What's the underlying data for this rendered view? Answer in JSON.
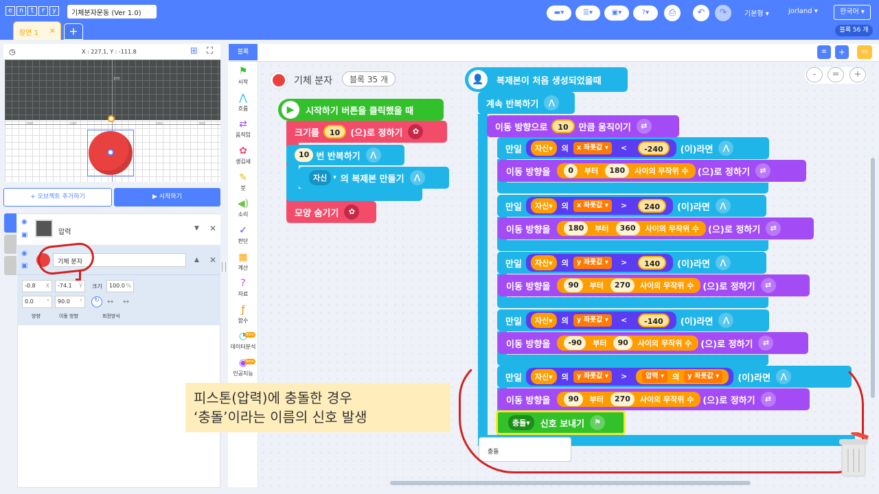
{
  "app": {
    "logo": "entry",
    "project_title": "기체분자운동 (Ver 1.0)"
  },
  "scene_tab": {
    "label": "장면 1",
    "close": "×",
    "add": "+"
  },
  "toolbar": {
    "help": "?",
    "mode": "기본형",
    "user": "jorland",
    "language": "한국어",
    "block_count": "블록 56 개"
  },
  "stage": {
    "coords": "X : 227.1, Y : -111.8",
    "axis_ticks": [
      "-200",
      "-100",
      "100",
      "200"
    ],
    "y_tick": "100"
  },
  "buttons": {
    "add_object": "+ 오브젝트 추가하기",
    "start": "▶ 시작하기"
  },
  "objects": [
    {
      "name": "압력"
    },
    {
      "name": "기체 분자"
    }
  ],
  "object_props": {
    "x": "-0.8",
    "x_unit": "X",
    "y": "-74.1",
    "y_unit": "Y",
    "size_label": "크기",
    "size": "100.0",
    "size_unit": "%",
    "direction": "0.0",
    "direction_unit": "°",
    "move_direction": "90.0",
    "move_unit": "°",
    "direction_label": "방향",
    "move_direction_label": "이동 방향",
    "rotation_label": "회전방식"
  },
  "palette": {
    "tab": "블록",
    "categories": [
      "시작",
      "흐름",
      "움직임",
      "생김새",
      "붓",
      "소리",
      "판단",
      "계산",
      "자료",
      "함수",
      "데이터분석",
      "인공지능"
    ],
    "beta": "Beta"
  },
  "workspace": {
    "object_header": {
      "name": "기체 분자",
      "count": "블록 35 개"
    },
    "script1": {
      "hat": "시작하기 버튼을 클릭했을 때",
      "b1_pre": "크기를",
      "b1_val": "10",
      "b1_post": "(으)로 정하기",
      "rep_val": "10",
      "rep_post": "번 반복하기",
      "clone_target": "자신",
      "clone_post": "의 복제본 만들기",
      "hide": "모양 숨기기"
    },
    "script2": {
      "hat": "복제본이 처음 생성되었을때",
      "loop": "계속 반복하기",
      "move_pre": "이동 방향으로",
      "move_val": "10",
      "move_post": "만큼 움직이기",
      "ifs": [
        {
          "self": "자신",
          "of": "의",
          "prop": "x 좌푯값",
          "op": "<",
          "val": "-240",
          "then": "(이)라면",
          "set_pre": "이동 방향을",
          "from": "0",
          "to_word": "부터",
          "to": "180",
          "rand": "사이의 무작위 수",
          "set_post": "(으)로 정하기"
        },
        {
          "self": "자신",
          "of": "의",
          "prop": "x 좌푯값",
          "op": ">",
          "val": "240",
          "then": "(이)라면",
          "set_pre": "이동 방향을",
          "from": "180",
          "to_word": "부터",
          "to": "360",
          "rand": "사이의 무작위 수",
          "set_post": "(으)로 정하기"
        },
        {
          "self": "자신",
          "of": "의",
          "prop": "y 좌푯값",
          "op": ">",
          "val": "140",
          "then": "(이)라면",
          "set_pre": "이동 방향을",
          "from": "90",
          "to_word": "부터",
          "to": "270",
          "rand": "사이의 무작위 수",
          "set_post": "(으)로 정하기"
        },
        {
          "self": "자신",
          "of": "의",
          "prop": "y 좌푯값",
          "op": "<",
          "val": "-140",
          "then": "(이)라면",
          "set_pre": "이동 방향을",
          "from": "-90",
          "to_word": "부터",
          "to": "90",
          "rand": "사이의 무작위 수",
          "set_post": "(으)로 정하기"
        }
      ],
      "collide": {
        "if": "만일",
        "self": "자신",
        "of": "의",
        "prop": "y 좌푯값",
        "op": ">",
        "target": "압력",
        "of2": "의",
        "prop2": "y 좌푯값",
        "then": "(이)라면",
        "set_pre": "이동 방향을",
        "from": "90",
        "to_word": "부터",
        "to": "270",
        "rand": "사이의 무작위 수",
        "set_post": "(으)로 정하기",
        "signal": "충돌",
        "signal_post": "신호 보내기"
      },
      "if_word": "만일"
    },
    "dropdown_item": "충돌",
    "zoom": [
      "-",
      "=",
      "+"
    ]
  },
  "annotation": {
    "line1": "피스톤(압력)에 충돌한 경우",
    "line2": "‘충돌’이라는 이름의 신호 발생"
  }
}
